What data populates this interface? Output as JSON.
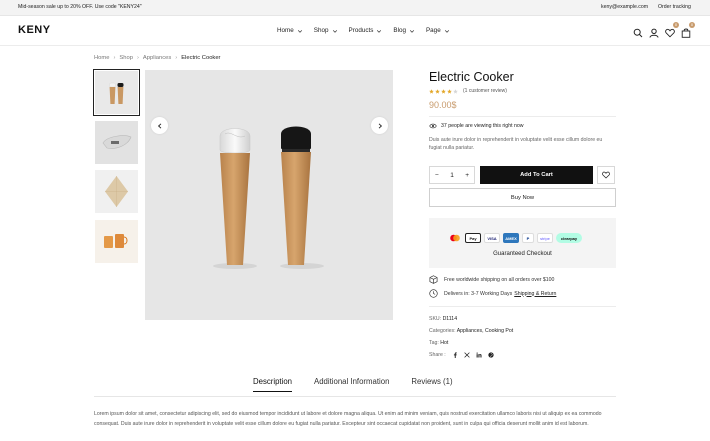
{
  "topbar": {
    "promo": "Mid-season sale up to 20% OFF. Use code \"KENY24\"",
    "email": "keny@example.com",
    "tracking": "Order tracking"
  },
  "header": {
    "logo": "KENY",
    "nav": [
      {
        "label": "Home"
      },
      {
        "label": "Shop"
      },
      {
        "label": "Products"
      },
      {
        "label": "Blog"
      },
      {
        "label": "Page"
      }
    ],
    "icons": [
      "search-icon",
      "user-icon",
      "heart-icon",
      "bag-icon"
    ],
    "wishlist_count": "0",
    "cart_count": "0"
  },
  "breadcrumb": {
    "items": [
      "Home",
      "Shop",
      "Appliances"
    ],
    "current": "Electric Cooker"
  },
  "gallery": {
    "thumbnails": [
      "salt-pepper-grinders",
      "gravy-boat",
      "napkin",
      "glass-mugs"
    ],
    "active_index": 0
  },
  "product": {
    "title": "Electric Cooker",
    "rating": 4,
    "rating_max": 5,
    "reviews_text": "(1 customer review)",
    "price": "90.00$",
    "viewing_text": "37 people are viewing this right now",
    "description": "Duis aute irure dolor in reprehenderit in voluptate velit esse cillum dolore eu fugiat nulla pariatur.",
    "quantity": "1",
    "add_to_cart": "Add To Cart",
    "buy_now": "Buy Now",
    "checkout_title": "Guaranteed Checkout",
    "payments": [
      "Mastercard",
      "Pay",
      "VISA",
      "AMEX",
      "P",
      "stripe",
      "clearpay"
    ],
    "shipping": {
      "free_text": "Free worldwide shipping on all orders over $100",
      "delivery_text": "Delivers in: 3-7 Working Days",
      "delivery_link": "Shipping & Return"
    },
    "sku_label": "SKU:",
    "sku": "D1114",
    "categories_label": "Categories:",
    "categories": "Appliances, Cooking Pot",
    "tag_label": "Tag:",
    "tag": "Hot",
    "share_label": "Share :"
  },
  "tabs": [
    {
      "label": "Description"
    },
    {
      "label": "Additional Information"
    },
    {
      "label": "Reviews (1)"
    }
  ],
  "description_body": "Lorem ipsum dolor sit amet, consectetur adipiscing elit, sed do eiusmod tempor incididunt ut labore et dolore magna aliqua. Ut enim ad minim veniam, quis nostrud exercitation ullamco laboris nisi ut aliquip ex ea commodo consequat. Duis aute irure dolor in reprehenderit in voluptate velit esse cillum dolore eu fugiat nulla pariatur. Excepteur sint occaecat cupidatat non proident, sunt in culpa qui officia deserunt mollit anim id est laborum.",
  "colors": {
    "accent": "#c89b6d",
    "button": "#111111",
    "muted_bg": "#f4f4f4"
  }
}
